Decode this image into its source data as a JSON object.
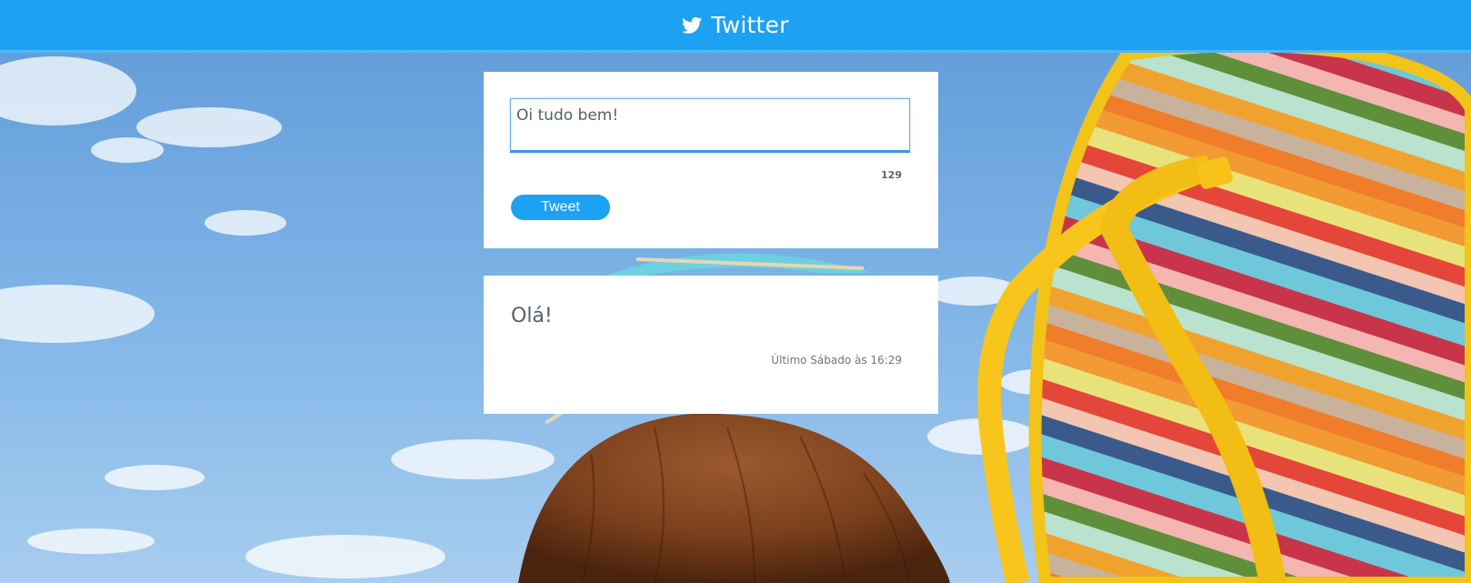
{
  "header": {
    "title": "Twitter",
    "icon": "twitter-bird-icon",
    "background_color": "#1da1f2"
  },
  "compose": {
    "input_value": "Oi tudo bem!",
    "char_counter": "129",
    "button_label": "Tweet"
  },
  "feed": {
    "tweets": [
      {
        "text": "Olá!",
        "time": "Último Sábado às 16:29"
      }
    ]
  },
  "background": {
    "description_icons": [
      "coconut-image",
      "flip-flop-image",
      "sky-image"
    ]
  }
}
